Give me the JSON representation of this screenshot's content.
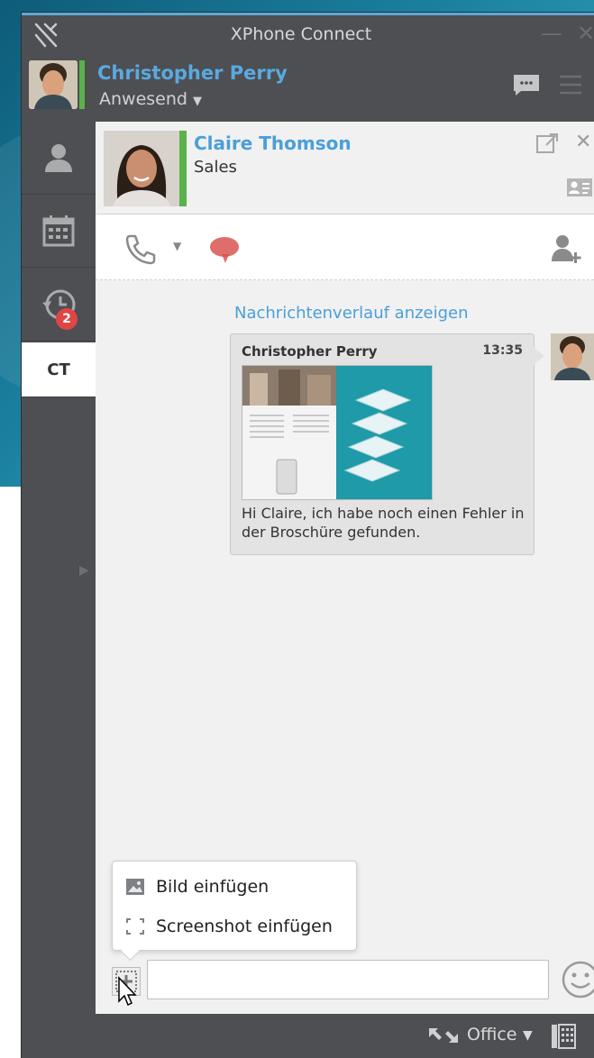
{
  "window": {
    "title": "XPhone Connect"
  },
  "user": {
    "name": "Christopher Perry",
    "presence": "Anwesend"
  },
  "sidebar": {
    "items": [
      {
        "name": "contacts",
        "icon": "person-icon"
      },
      {
        "name": "calendar",
        "icon": "calendar-icon"
      },
      {
        "name": "history",
        "icon": "history-icon",
        "badge": "2"
      },
      {
        "name": "ct-tab",
        "label": "CT"
      }
    ]
  },
  "contact": {
    "name": "Claire Thomson",
    "department": "Sales"
  },
  "chat": {
    "history_link": "Nachrichtenverlauf anzeigen",
    "messages": [
      {
        "sender": "Christopher Perry",
        "time": "13:35",
        "text": "Hi Claire, ich habe noch einen Fehler in der Broschüre gefunden."
      }
    ]
  },
  "attach_menu": {
    "items": [
      {
        "label": "Bild einfügen",
        "icon": "image-icon"
      },
      {
        "label": "Screenshot einfügen",
        "icon": "screenshot-icon"
      }
    ]
  },
  "input": {
    "value": ""
  },
  "statusbar": {
    "location": "Office"
  },
  "colors": {
    "accent": "#4a9fd9",
    "presence_available": "#5ab24a",
    "badge": "#e04545",
    "window_chrome": "#4d4f52",
    "chat_icon": "#d9534f"
  }
}
